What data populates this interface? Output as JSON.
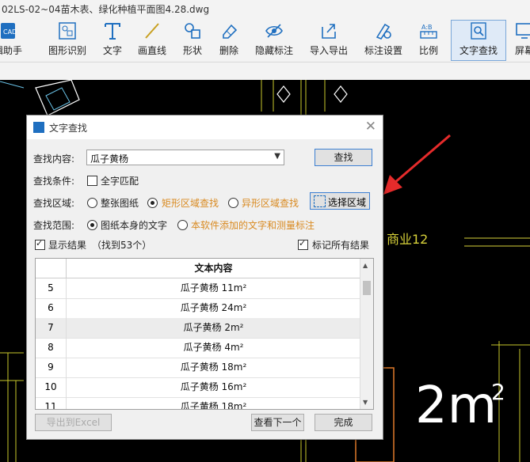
{
  "window": {
    "title": "02LS-02~04苗木表、绿化种植平面图4.28.dwg"
  },
  "toolbar": {
    "items": [
      {
        "label": "辑助手",
        "icon": "assistant-icon"
      },
      {
        "label": "图形识别",
        "icon": "shape-recognition-icon"
      },
      {
        "label": "文字",
        "icon": "text-icon"
      },
      {
        "label": "画直线",
        "icon": "line-icon"
      },
      {
        "label": "形状",
        "icon": "shape-icon"
      },
      {
        "label": "删除",
        "icon": "eraser-icon"
      },
      {
        "label": "隐藏标注",
        "icon": "eye-off-icon"
      },
      {
        "label": "导入导出",
        "icon": "import-export-icon"
      },
      {
        "label": "标注设置",
        "icon": "annotation-settings-icon"
      },
      {
        "label": "比例",
        "icon": "scale-icon"
      },
      {
        "label": "文字查找",
        "icon": "text-search-icon"
      },
      {
        "label": "屏幕",
        "icon": "screen-icon"
      }
    ]
  },
  "canvas": {
    "label_right": "商业12",
    "big_text": "2m",
    "big_superscript": "2"
  },
  "dialog": {
    "title": "文字查找",
    "search_label": "查找内容:",
    "search_value": "瓜子黄杨",
    "find_button": "查找",
    "condition_label": "查找条件:",
    "whole_word": "全字匹配",
    "area_label": "查找区域:",
    "area_options": [
      "整张图纸",
      "矩形区域查找",
      "异形区域查找"
    ],
    "select_area_button": "选择区域",
    "scope_label": "查找范围:",
    "scope_options": [
      "图纸本身的文字",
      "本软件添加的文字和测量标注"
    ],
    "show_results": "显示结果",
    "found_count": "（找到53个）",
    "mark_all": "标记所有结果",
    "table": {
      "header": "文本内容",
      "rows": [
        {
          "n": "5",
          "t": "瓜子黄杨 11m²"
        },
        {
          "n": "6",
          "t": "瓜子黄杨 24m²"
        },
        {
          "n": "7",
          "t": "瓜子黄杨 2m²"
        },
        {
          "n": "8",
          "t": "瓜子黄杨 4m²"
        },
        {
          "n": "9",
          "t": "瓜子黄杨 18m²"
        },
        {
          "n": "10",
          "t": "瓜子黄杨 16m²"
        },
        {
          "n": "11",
          "t": "瓜子黄杨 18m²"
        }
      ]
    },
    "export_button": "导出到Excel",
    "next_button": "查看下一个",
    "done_button": "完成"
  }
}
